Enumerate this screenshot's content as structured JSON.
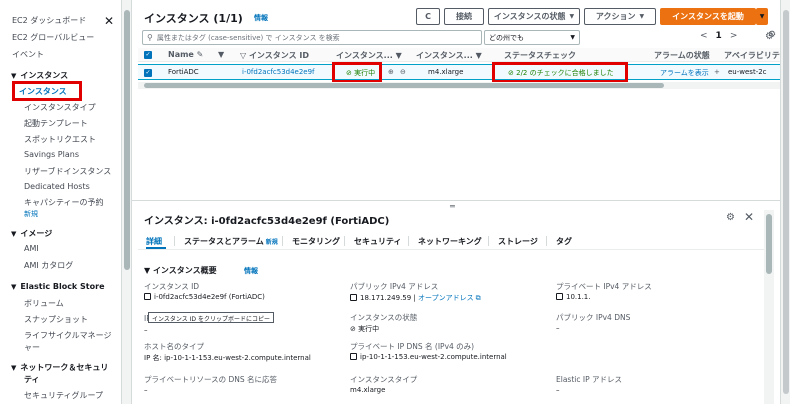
{
  "sidebar": {
    "items_top": [
      "EC2 ダッシュボード",
      "EC2 グローバルビュー",
      "イベント"
    ],
    "sections": [
      {
        "label": "インスタンス"
      },
      {
        "label": "イメージ"
      },
      {
        "label": "Elastic Block Store"
      },
      {
        "label": "ネットワーク＆セキュリ"
      },
      {
        "label": "ティ"
      }
    ],
    "instances_items": [
      "インスタンス",
      "インスタンスタイプ",
      "起動テンプレート",
      "スポットリクエスト",
      "Savings Plans",
      "リザーブドインスタンス",
      "Dedicated Hosts",
      "キャパシティーの予約"
    ],
    "new_badge": "新規",
    "image_items": [
      "AMI",
      "AMI カタログ"
    ],
    "ebs_items": [
      "ボリューム",
      "スナップショット",
      "ライフサイクルマネージ",
      "ャー"
    ],
    "network_items": [
      "セキュリティグループ"
    ]
  },
  "header": {
    "title": "インスタンス (1/1)",
    "info": "情報",
    "refresh_label": "C",
    "connect_label": "接続",
    "state_label": "インスタンスの状態",
    "actions_label": "アクション",
    "launch_label": "インスタンスを起動"
  },
  "search": {
    "placeholder": "属性またはタグ (case-sensitive) で インスタンス を検索",
    "filter_value": "どの州でも"
  },
  "pager": {
    "prev": "<",
    "page": "1",
    "next": ">"
  },
  "table": {
    "headers": [
      "Name",
      "インスタンス ID",
      "インスタンス...",
      "インスタンス...",
      "ステータスチェック",
      "アラームの状態",
      "アベイラビリティ"
    ],
    "row": {
      "name": "FortiADC",
      "id": "i-0fd2acfc53d4e2e9f",
      "state": "実行中",
      "type": "m4.xlarge",
      "status_check": "2/2 のチェックに合格しました",
      "alarm": "アラームを表示",
      "az": "eu-west-2c"
    }
  },
  "detail": {
    "title": "インスタンス: i-0fd2acfc53d4e2e9f (FortiADC)",
    "tabs": [
      "詳細",
      "ステータスとアラーム",
      "モニタリング",
      "セキュリティ",
      "ネットワーキング",
      "ストレージ",
      "タグ"
    ],
    "tab_new": "新規",
    "summary_title": "インスタンス概要",
    "summary_info": "情報",
    "fields": {
      "instance_id_label": "インスタンス ID",
      "instance_id_value": "i-0fd2acfc53d4e2e9f (FortiADC)",
      "public_ip_label": "パブリック IPv4 アドレス",
      "public_ip_value": "18.171.249.59",
      "open_address": "オープンアドレス",
      "private_ip_label": "プライベート IPv4 アドレス",
      "private_ip_value": "10.1.1.",
      "ipv6_label": "IP",
      "tooltip": "インスタンス ID をクリップボードにコピー",
      "dash1": "–",
      "state_label": "インスタンスの状態",
      "state_value": "実行中",
      "public_dns_label": "パブリック IPv4 DNS",
      "public_dns_value": "–",
      "hostname_type_label": "ホスト名のタイプ",
      "hostname_type_value": "IP 名: ip-10-1-1-153.eu-west-2.compute.internal",
      "private_dns_label": "プライベート IP DNS 名 (IPv4 のみ)",
      "private_dns_value": "ip-10-1-1-153.eu-west-2.compute.internal",
      "private_resource_dns_label": "プライベートリソースの DNS 名に応答",
      "private_resource_dns_value": "–",
      "instance_type_label": "インスタンスタイプ",
      "instance_type_value": "m4.xlarge",
      "elastic_ip_label": "Elastic IP アドレス",
      "elastic_ip_value": "–"
    }
  },
  "colors": {
    "accent": "#0073bb",
    "launch": "#ec7211",
    "ok": "#1d8102",
    "highlight_box": "#e00000"
  }
}
